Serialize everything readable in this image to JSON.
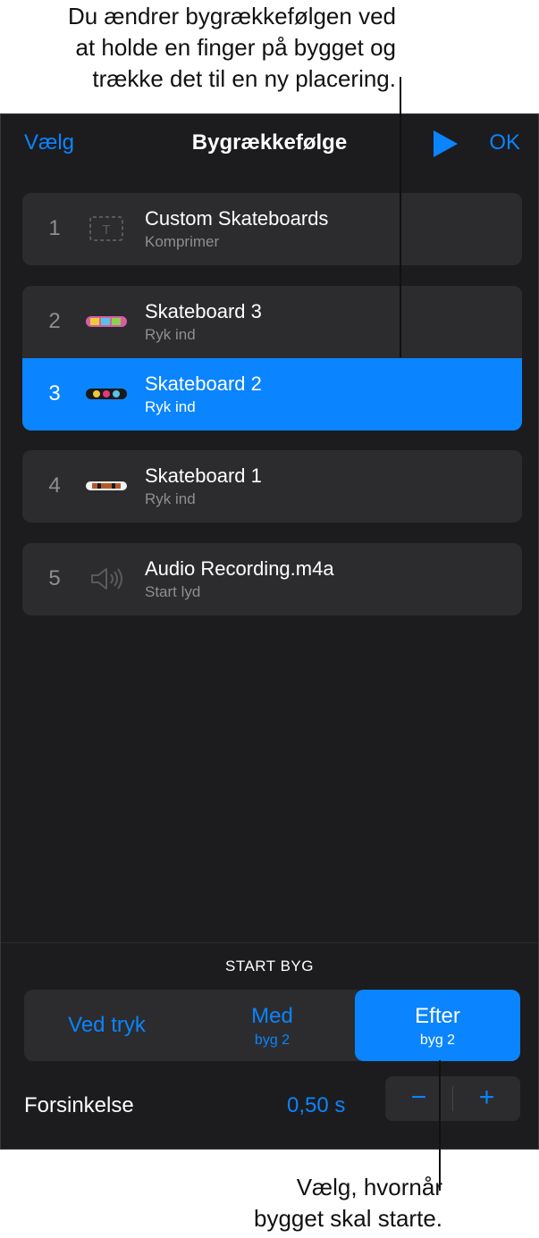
{
  "callouts": {
    "top": [
      "Du ændrer bygrækkefølgen ved",
      "at holde en finger på bygget og",
      "trække det til en ny placering."
    ],
    "bottom": [
      "Vælg, hvornår",
      "bygget skal starte."
    ]
  },
  "navbar": {
    "left_label": "Vælg",
    "title": "Bygrækkefølge",
    "play_icon": "play-icon",
    "ok_label": "OK"
  },
  "builds": [
    {
      "number": "1",
      "name": "Custom Skateboards",
      "effect": "Komprimer",
      "icon": "text-box-icon"
    },
    {
      "number": "2",
      "name": "Skateboard 3",
      "effect": "Ryk ind",
      "icon": "skateboard-thumbnail"
    },
    {
      "number": "3",
      "name": "Skateboard 2",
      "effect": "Ryk ind",
      "icon": "skateboard-thumbnail",
      "selected": true
    },
    {
      "number": "4",
      "name": "Skateboard 1",
      "effect": "Ryk ind",
      "icon": "skateboard-thumbnail"
    },
    {
      "number": "5",
      "name": "Audio Recording.m4a",
      "effect": "Start lyd",
      "icon": "speaker-icon"
    }
  ],
  "start_build": {
    "label": "START BYG",
    "options": [
      {
        "label": "Ved tryk",
        "sub": ""
      },
      {
        "label": "Med",
        "sub": "byg 2"
      },
      {
        "label": "Efter",
        "sub": "byg 2"
      }
    ],
    "selected": "Efter"
  },
  "delay": {
    "label": "Forsinkelse",
    "value": "0,50 s",
    "minus": "−",
    "plus": "+"
  },
  "colors": {
    "accent": "#0a84ff",
    "background": "#1c1c1e",
    "cell": "#2c2c2e",
    "secondary_text": "#8e8e93"
  }
}
